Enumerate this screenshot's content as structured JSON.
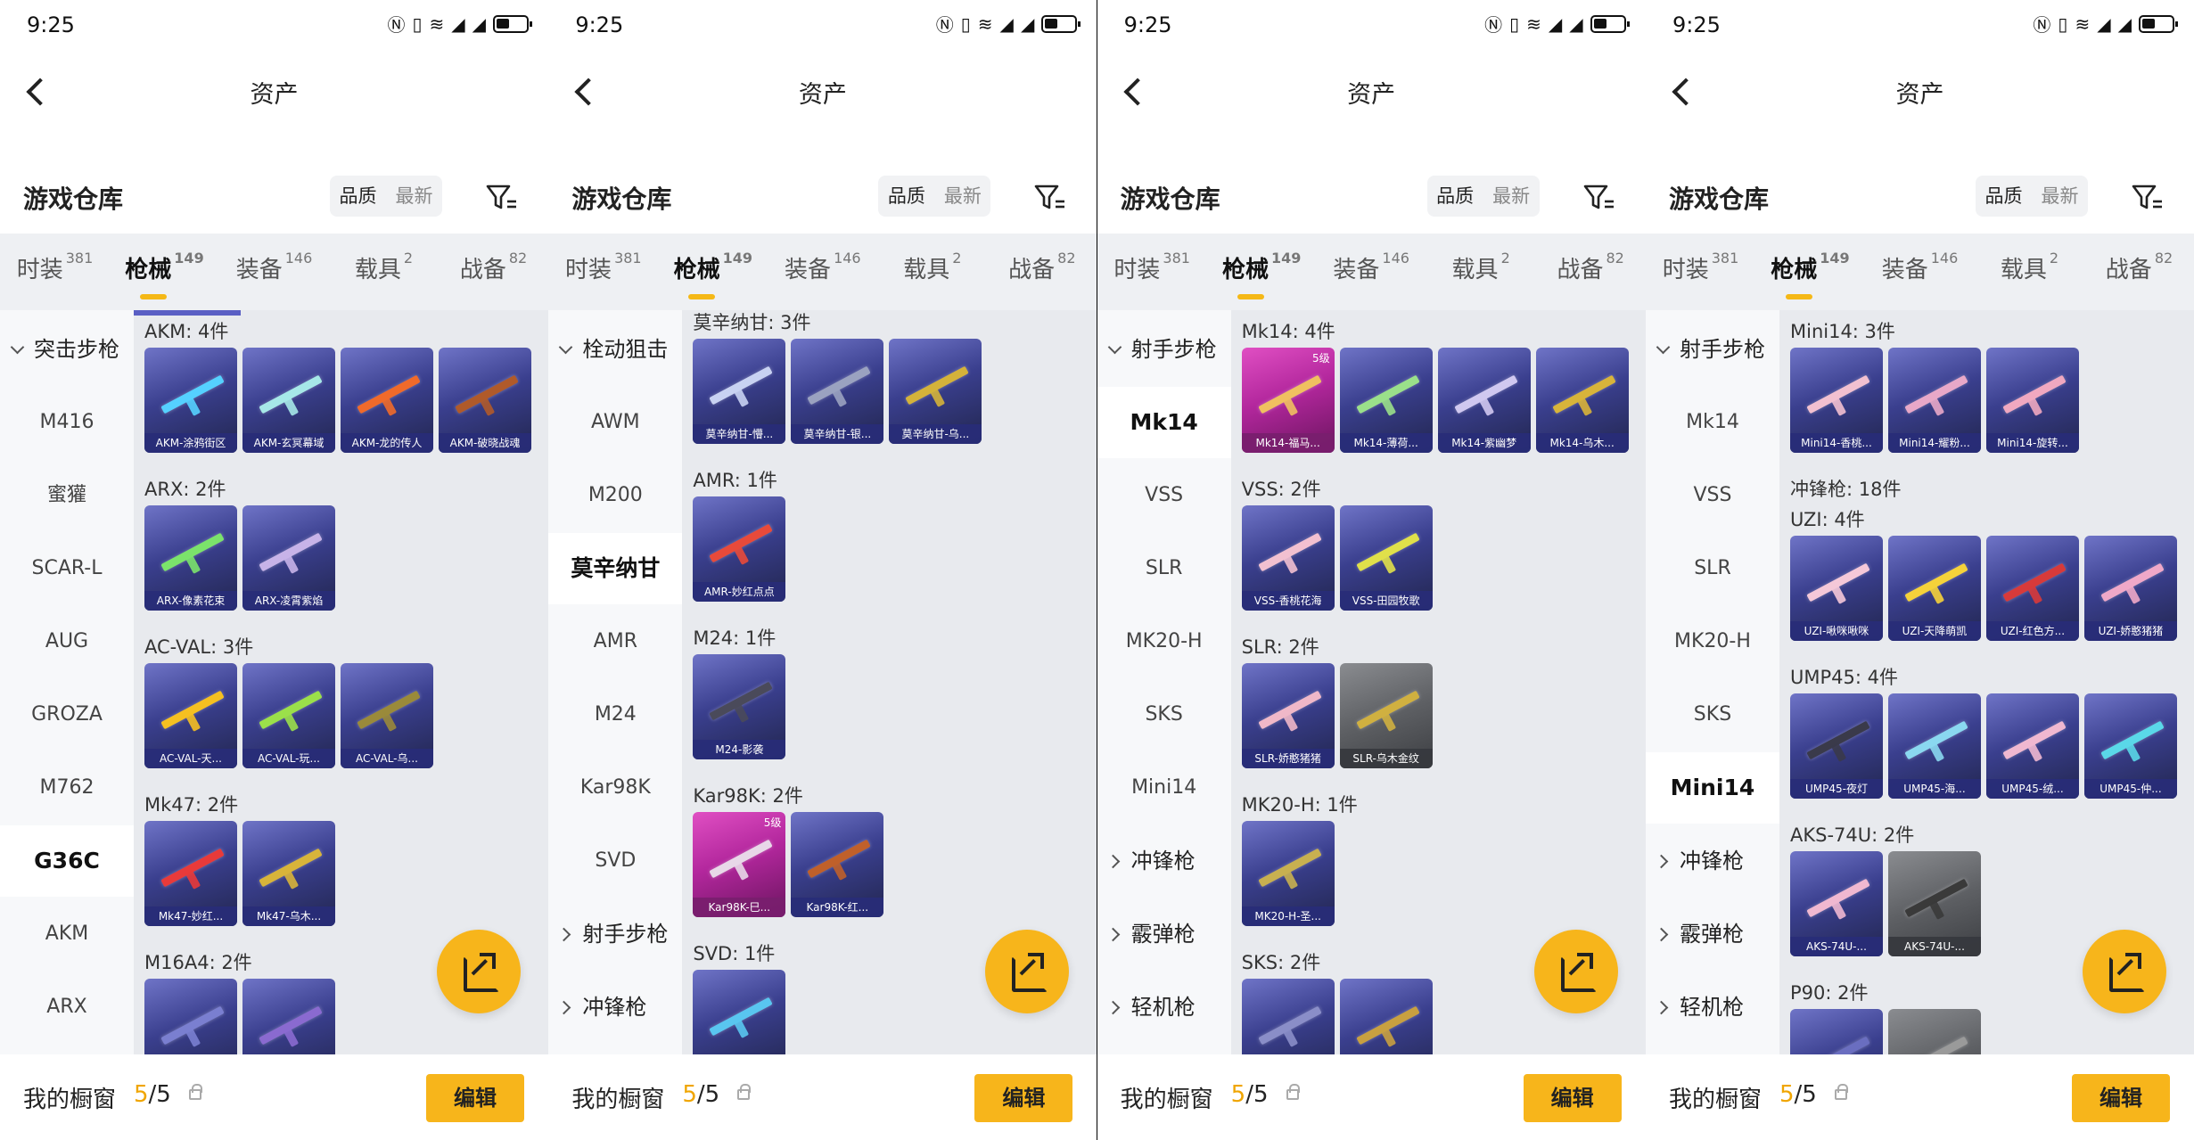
{
  "status_time": "9:25",
  "nav_title": "资产",
  "header_title": "游戏仓库",
  "sort": {
    "quality": "品质",
    "latest": "最新"
  },
  "tabs": [
    {
      "label": "时装",
      "count": "381"
    },
    {
      "label": "枪械",
      "count": "149"
    },
    {
      "label": "装备",
      "count": "146"
    },
    {
      "label": "载具",
      "count": "2"
    },
    {
      "label": "战备",
      "count": "82"
    }
  ],
  "footer": {
    "label": "我的橱窗",
    "count_a": "5",
    "count_b": "/5",
    "edit": "编辑"
  },
  "screens": [
    {
      "side": [
        {
          "type": "group",
          "label": "突击步枪"
        },
        {
          "type": "item",
          "label": "M416"
        },
        {
          "type": "item",
          "label": "蜜獾"
        },
        {
          "type": "item",
          "label": "SCAR-L"
        },
        {
          "type": "item",
          "label": "AUG"
        },
        {
          "type": "item",
          "label": "GROZA"
        },
        {
          "type": "item",
          "label": "M762"
        },
        {
          "type": "sel",
          "label": "G36C"
        },
        {
          "type": "item",
          "label": "AKM"
        },
        {
          "type": "item",
          "label": "ARX"
        }
      ],
      "sections": [
        {
          "title": "AKM: 4件",
          "cards": [
            {
              "label": "AKM-涂鸦街区",
              "color": "#55d1ff"
            },
            {
              "label": "AKM-玄冥幕域",
              "color": "#a6e8e8"
            },
            {
              "label": "AKM-龙的传人",
              "color": "#f06a2a"
            },
            {
              "label": "AKM-破晓战魂",
              "color": "#b05a2a"
            }
          ]
        },
        {
          "title": "ARX: 2件",
          "cards": [
            {
              "label": "ARX-像素花束",
              "color": "#7be36b"
            },
            {
              "label": "ARX-凌霄紫焰",
              "color": "#c7b3e8"
            }
          ]
        },
        {
          "title": "AC-VAL: 3件",
          "cards": [
            {
              "label": "AC-VAL-天...",
              "color": "#f5c021"
            },
            {
              "label": "AC-VAL-玩...",
              "color": "#9be04a"
            },
            {
              "label": "AC-VAL-乌...",
              "color": "#9a8a3a"
            }
          ]
        },
        {
          "title": "Mk47: 2件",
          "cards": [
            {
              "label": "Mk47-妙红...",
              "color": "#e83a3a"
            },
            {
              "label": "Mk47-乌木...",
              "color": "#d8b43a"
            }
          ]
        },
        {
          "title": "M16A4: 2件",
          "cards": [
            {
              "label": "",
              "color": "#7a7fd0"
            },
            {
              "label": "",
              "color": "#8a6ad0"
            }
          ]
        }
      ]
    },
    {
      "side": [
        {
          "type": "group",
          "label": "栓动狙击"
        },
        {
          "type": "item",
          "label": "AWM"
        },
        {
          "type": "item",
          "label": "M200"
        },
        {
          "type": "sel",
          "label": "莫辛纳甘"
        },
        {
          "type": "item",
          "label": "AMR"
        },
        {
          "type": "item",
          "label": "M24"
        },
        {
          "type": "item",
          "label": "Kar98K"
        },
        {
          "type": "item",
          "label": "SVD"
        },
        {
          "type": "closed",
          "label": "射手步枪"
        },
        {
          "type": "closed",
          "label": "冲锋枪"
        }
      ],
      "sections": [
        {
          "title": "莫辛纳甘: 3件",
          "cards": [
            {
              "label": "莫辛纳甘-懵...",
              "color": "#c8d2f2"
            },
            {
              "label": "莫辛纳甘-银...",
              "color": "#9aa2c0"
            },
            {
              "label": "莫辛纳甘-乌...",
              "color": "#d4b23a"
            }
          ]
        },
        {
          "title": "AMR: 1件",
          "cards": [
            {
              "label": "AMR-妙红点点",
              "color": "#e84a3a"
            }
          ]
        },
        {
          "title": "M24: 1件",
          "cards": [
            {
              "label": "M24-影袭",
              "color": "#4a4a5a"
            }
          ]
        },
        {
          "title": "Kar98K: 2件",
          "cards": [
            {
              "label": "Kar98K-巳...",
              "color": "#e8d8e8",
              "pink": true,
              "level": "5级"
            },
            {
              "label": "Kar98K-红...",
              "color": "#c0602a"
            }
          ]
        },
        {
          "title": "SVD: 1件",
          "cards": [
            {
              "label": "",
              "color": "#59c6f0"
            }
          ]
        }
      ]
    },
    {
      "side": [
        {
          "type": "group",
          "label": "射手步枪"
        },
        {
          "type": "sel",
          "label": "Mk14"
        },
        {
          "type": "item",
          "label": "VSS"
        },
        {
          "type": "item",
          "label": "SLR"
        },
        {
          "type": "item",
          "label": "MK20-H"
        },
        {
          "type": "item",
          "label": "SKS"
        },
        {
          "type": "item",
          "label": "Mini14"
        },
        {
          "type": "closed",
          "label": "冲锋枪"
        },
        {
          "type": "closed",
          "label": "霰弹枪"
        },
        {
          "type": "closed",
          "label": "轻机枪"
        }
      ],
      "sections": [
        {
          "title": "Mk14: 4件",
          "cards": [
            {
              "label": "Mk14-福马...",
              "color": "#f0c060",
              "pink": true,
              "level": "5级"
            },
            {
              "label": "Mk14-薄荷...",
              "color": "#9ae08a"
            },
            {
              "label": "Mk14-紫幽梦",
              "color": "#d0c8f0"
            },
            {
              "label": "Mk14-乌木...",
              "color": "#d8b43a"
            }
          ]
        },
        {
          "title": "VSS: 2件",
          "cards": [
            {
              "label": "VSS-香桃花海",
              "color": "#f2c0d0"
            },
            {
              "label": "VSS-田园牧歌",
              "color": "#e0e04a"
            }
          ]
        },
        {
          "title": "SLR: 2件",
          "cards": [
            {
              "label": "SLR-娇憨猪猪",
              "color": "#f0b8c8"
            },
            {
              "label": "SLR-乌木金纹",
              "color": "#d0b040",
              "gray": true
            }
          ]
        },
        {
          "title": "MK20-H: 1件",
          "cards": [
            {
              "label": "MK20-H-圣...",
              "color": "#c8b050"
            }
          ]
        },
        {
          "title": "SKS: 2件",
          "cards": [
            {
              "label": "",
              "color": "#8a8ec8"
            },
            {
              "label": "",
              "color": "#c8a040"
            }
          ]
        }
      ]
    },
    {
      "side": [
        {
          "type": "group",
          "label": "射手步枪"
        },
        {
          "type": "item",
          "label": "Mk14"
        },
        {
          "type": "item",
          "label": "VSS"
        },
        {
          "type": "item",
          "label": "SLR"
        },
        {
          "type": "item",
          "label": "MK20-H"
        },
        {
          "type": "item",
          "label": "SKS"
        },
        {
          "type": "sel",
          "label": "Mini14"
        },
        {
          "type": "closed",
          "label": "冲锋枪"
        },
        {
          "type": "closed",
          "label": "霰弹枪"
        },
        {
          "type": "closed",
          "label": "轻机枪"
        }
      ],
      "sections": [
        {
          "title": "Mini14: 3件",
          "cards": [
            {
              "label": "Mini14-香桃...",
              "color": "#f2c0d0"
            },
            {
              "label": "Mini14-耀粉...",
              "color": "#e8a8c8"
            },
            {
              "label": "Mini14-旋转...",
              "color": "#f0a8c0"
            }
          ]
        },
        {
          "title": "冲锋枪: 18件",
          "cards": []
        },
        {
          "title": "UZI: 4件",
          "cards": [
            {
              "label": "UZI-啾咪啾咪",
              "color": "#f5c8d8"
            },
            {
              "label": "UZI-天降萌凯",
              "color": "#f5d23a"
            },
            {
              "label": "UZI-红色方...",
              "color": "#d83a3a"
            },
            {
              "label": "UZI-娇憨猪猪",
              "color": "#f0a8c8"
            }
          ]
        },
        {
          "title": "UMP45: 4件",
          "cards": [
            {
              "label": "UMP45-夜灯",
              "color": "#3a3a4a"
            },
            {
              "label": "UMP45-海...",
              "color": "#8ad8f0"
            },
            {
              "label": "UMP45-绒...",
              "color": "#f0b8d0"
            },
            {
              "label": "UMP45-仲...",
              "color": "#5ad8e8"
            }
          ]
        },
        {
          "title": "AKS-74U: 2件",
          "cards": [
            {
              "label": "AKS-74U-...",
              "color": "#f0b8d0"
            },
            {
              "label": "AKS-74U-...",
              "color": "#3a3a3a",
              "gray": true
            }
          ]
        },
        {
          "title": "P90: 2件",
          "cards": [
            {
              "label": "",
              "color": "#6a6ec0"
            },
            {
              "label": "",
              "color": "#9a9a9a",
              "gray": true
            }
          ]
        }
      ]
    }
  ]
}
